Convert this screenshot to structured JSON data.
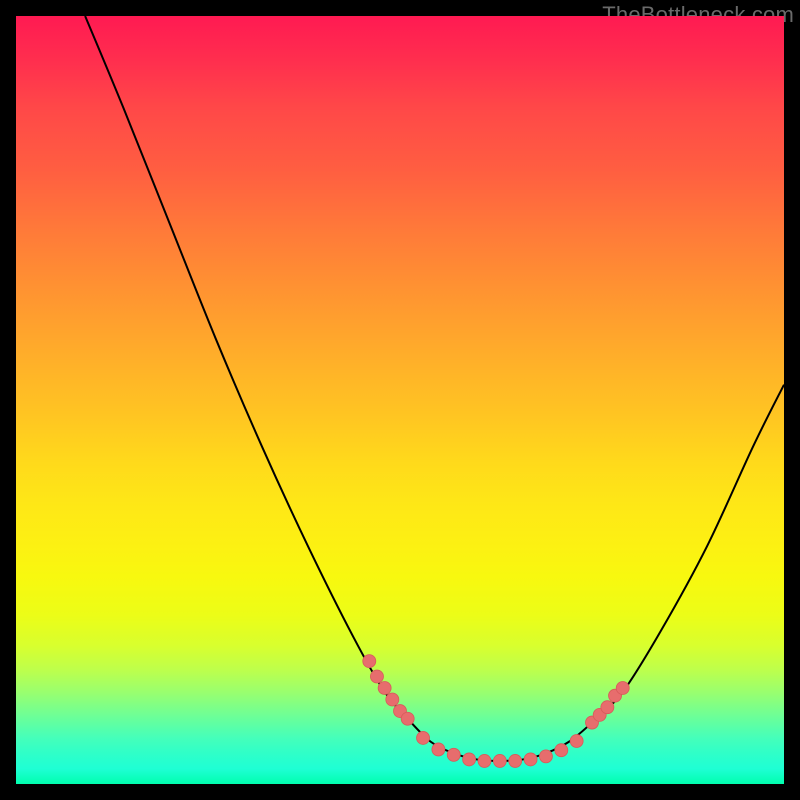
{
  "watermark": "TheBottleneck.com",
  "chart_data": {
    "type": "line",
    "title": "",
    "xlabel": "",
    "ylabel": "",
    "xlim": [
      0,
      100
    ],
    "ylim": [
      0,
      100
    ],
    "curve_xy": [
      [
        9,
        100
      ],
      [
        14,
        88
      ],
      [
        20,
        73
      ],
      [
        26,
        58
      ],
      [
        32,
        44
      ],
      [
        38,
        31
      ],
      [
        44,
        19
      ],
      [
        48,
        12
      ],
      [
        51,
        8.5
      ],
      [
        54,
        5.5
      ],
      [
        57,
        4
      ],
      [
        60,
        3.2
      ],
      [
        63,
        3
      ],
      [
        66,
        3.2
      ],
      [
        69,
        4
      ],
      [
        72,
        5.5
      ],
      [
        75,
        8
      ],
      [
        79,
        12
      ],
      [
        84,
        20
      ],
      [
        90,
        31
      ],
      [
        96,
        44
      ],
      [
        100,
        52
      ]
    ],
    "points_xy": [
      [
        46,
        16
      ],
      [
        47,
        14
      ],
      [
        48,
        12.5
      ],
      [
        49,
        11
      ],
      [
        50,
        9.5
      ],
      [
        51,
        8.5
      ],
      [
        53,
        6
      ],
      [
        55,
        4.5
      ],
      [
        57,
        3.8
      ],
      [
        59,
        3.2
      ],
      [
        61,
        3.0
      ],
      [
        63,
        3.0
      ],
      [
        65,
        3.0
      ],
      [
        67,
        3.2
      ],
      [
        69,
        3.6
      ],
      [
        71,
        4.4
      ],
      [
        73,
        5.6
      ],
      [
        75,
        8
      ],
      [
        76,
        9
      ],
      [
        77,
        10
      ],
      [
        78,
        11.5
      ],
      [
        79,
        12.5
      ]
    ],
    "colors": {
      "curve": "#000000",
      "point_fill": "#e76d6d",
      "point_stroke": "#d85a5a"
    }
  }
}
